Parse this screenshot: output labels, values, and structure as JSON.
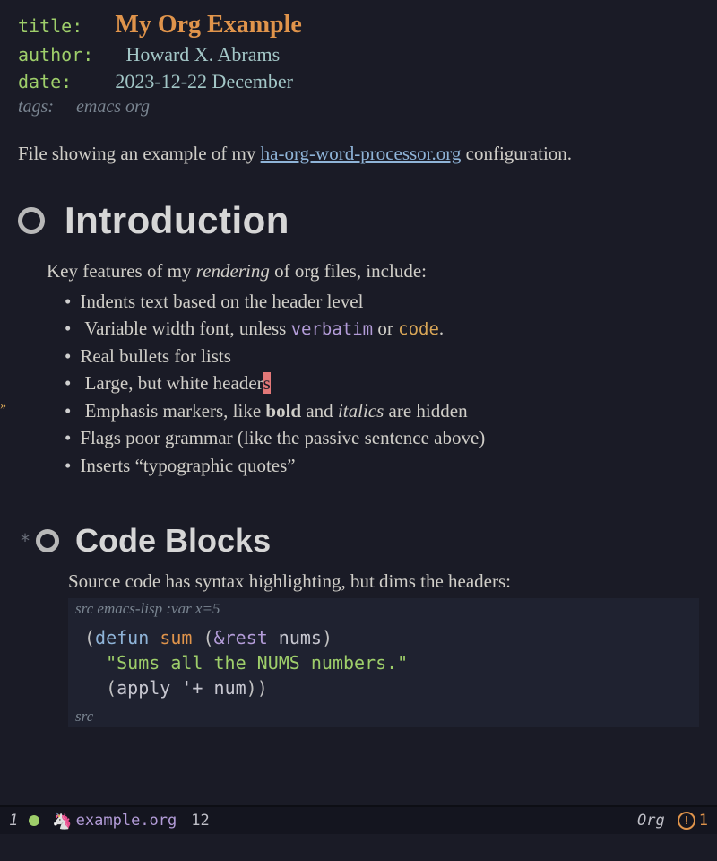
{
  "meta": {
    "title_key": "title:",
    "title_val": "My Org Example",
    "author_key": "author:",
    "author_val": "Howard X. Abrams",
    "date_key": "date:",
    "date_val": "2023-12-22 December",
    "tags_key": "tags:",
    "tags_val": "emacs org"
  },
  "intro": {
    "pre": "File showing an example of my ",
    "link": "ha-org-word-processor.org",
    "post": " configuration."
  },
  "h1": "Introduction",
  "features_intro_pre": "Key features of my ",
  "features_intro_ital": "rendering",
  "features_intro_post": " of org files, include:",
  "bullets": {
    "b0": "Indents text based on the header level",
    "b1_pre": "Variable width font, unless ",
    "b1_verb": "verbatim",
    "b1_mid": " or ",
    "b1_code": "code",
    "b1_post": ".",
    "b2": "Real bullets for lists",
    "b3_pre": "Large, but white header",
    "b3_cursor": "s",
    "b4_pre": "Emphasis markers, like ",
    "b4_bold": "bold",
    "b4_mid": " and ",
    "b4_ital": "italics",
    "b4_post": " are hidden",
    "b5": "Flags poor grammar (like the passive sentence above)",
    "b6": "Inserts “typographic quotes”"
  },
  "star": "*",
  "h2": "Code Blocks",
  "src_intro": "Source code has syntax highlighting, but dims the headers:",
  "src_header_pre": "src ",
  "src_header_lang": "emacs-lisp :var x=5",
  "code": {
    "l1_open": "(",
    "l1_defun": "defun",
    "l1_sp1": " ",
    "l1_name": "sum",
    "l1_sp2": " ",
    "l1_args_open": "(",
    "l1_rest": "&rest",
    "l1_sp3": " ",
    "l1_nums": "nums",
    "l1_args_close": ")",
    "l2_str": "\"Sums all the NUMS numbers.\"",
    "l3_open": "(",
    "l3_apply": "apply",
    "l3_sp": " ",
    "l3_quote": "'+",
    "l3_sp2": " ",
    "l3_num": "num",
    "l3_close": "))"
  },
  "src_footer": "src",
  "modeline": {
    "winnum": "1",
    "filename": "example.org",
    "line": "12",
    "mode": "Org",
    "warn_count": "1"
  }
}
